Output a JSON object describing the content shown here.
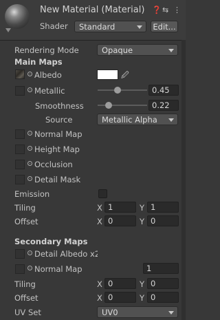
{
  "header": {
    "title": "New Material (Material)",
    "shader_label": "Shader",
    "shader_value": "Standard",
    "edit_label": "Edit...",
    "icons": [
      "help-icon",
      "preset-icon",
      "menu-icon"
    ]
  },
  "main": {
    "rendering_mode_label": "Rendering Mode",
    "rendering_mode_value": "Opaque",
    "main_maps_title": "Main Maps",
    "albedo_label": "Albedo",
    "albedo_color": "#ffffff",
    "metallic_label": "Metallic",
    "metallic_value": "0.45",
    "smoothness_label": "Smoothness",
    "smoothness_value": "0.22",
    "source_label": "Source",
    "source_value": "Metallic Alpha",
    "normal_map_label": "Normal Map",
    "height_map_label": "Height Map",
    "occlusion_label": "Occlusion",
    "detail_mask_label": "Detail Mask",
    "emission_label": "Emission",
    "tiling_label": "Tiling",
    "tiling_x": "1",
    "tiling_y": "1",
    "offset_label": "Offset",
    "offset_x": "0",
    "offset_y": "0",
    "x_label": "X",
    "y_label": "Y"
  },
  "secondary": {
    "title": "Secondary Maps",
    "detail_albedo_label": "Detail Albedo x2",
    "normal_map_label": "Normal Map",
    "normal_map_scale": "1",
    "tiling_label": "Tiling",
    "tiling_x": "0",
    "tiling_y": "0",
    "offset_label": "Offset",
    "offset_x": "0",
    "offset_y": "0",
    "uv_set_label": "UV Set",
    "uv_set_value": "UV0"
  },
  "colors": {
    "background": "#383838",
    "field": "#2a2a2a",
    "dropdown": "#515151",
    "text": "#c4c4c4"
  }
}
